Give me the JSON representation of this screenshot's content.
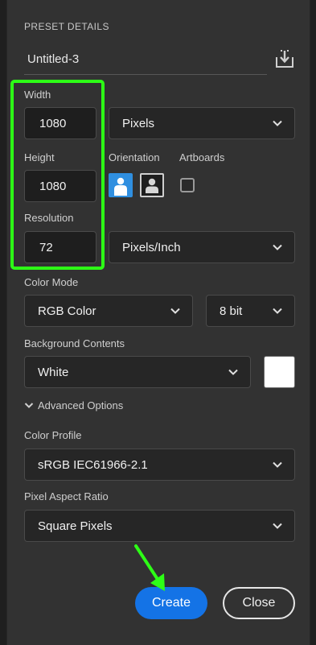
{
  "preset": {
    "section_title": "PRESET DETAILS",
    "name": "Untitled-3",
    "save_icon": "save-preset-icon"
  },
  "width": {
    "label": "Width",
    "value": "1080",
    "unit": "Pixels"
  },
  "height": {
    "label": "Height",
    "value": "1080"
  },
  "orientation": {
    "label": "Orientation",
    "selected": "portrait"
  },
  "artboards": {
    "label": "Artboards",
    "checked": false
  },
  "resolution": {
    "label": "Resolution",
    "value": "72",
    "unit": "Pixels/Inch"
  },
  "color_mode": {
    "label": "Color Mode",
    "mode": "RGB Color",
    "bits": "8 bit"
  },
  "background": {
    "label": "Background Contents",
    "value": "White",
    "swatch_color": "#ffffff"
  },
  "advanced": {
    "label": "Advanced Options",
    "expanded": true
  },
  "color_profile": {
    "label": "Color Profile",
    "value": "sRGB IEC61966-2.1"
  },
  "pixel_aspect": {
    "label": "Pixel Aspect Ratio",
    "value": "Square Pixels"
  },
  "actions": {
    "create_label": "Create",
    "close_label": "Close"
  },
  "colors": {
    "highlight": "#2dff16",
    "accent": "#1473e6",
    "orientation_selected": "#2f8fe0"
  }
}
